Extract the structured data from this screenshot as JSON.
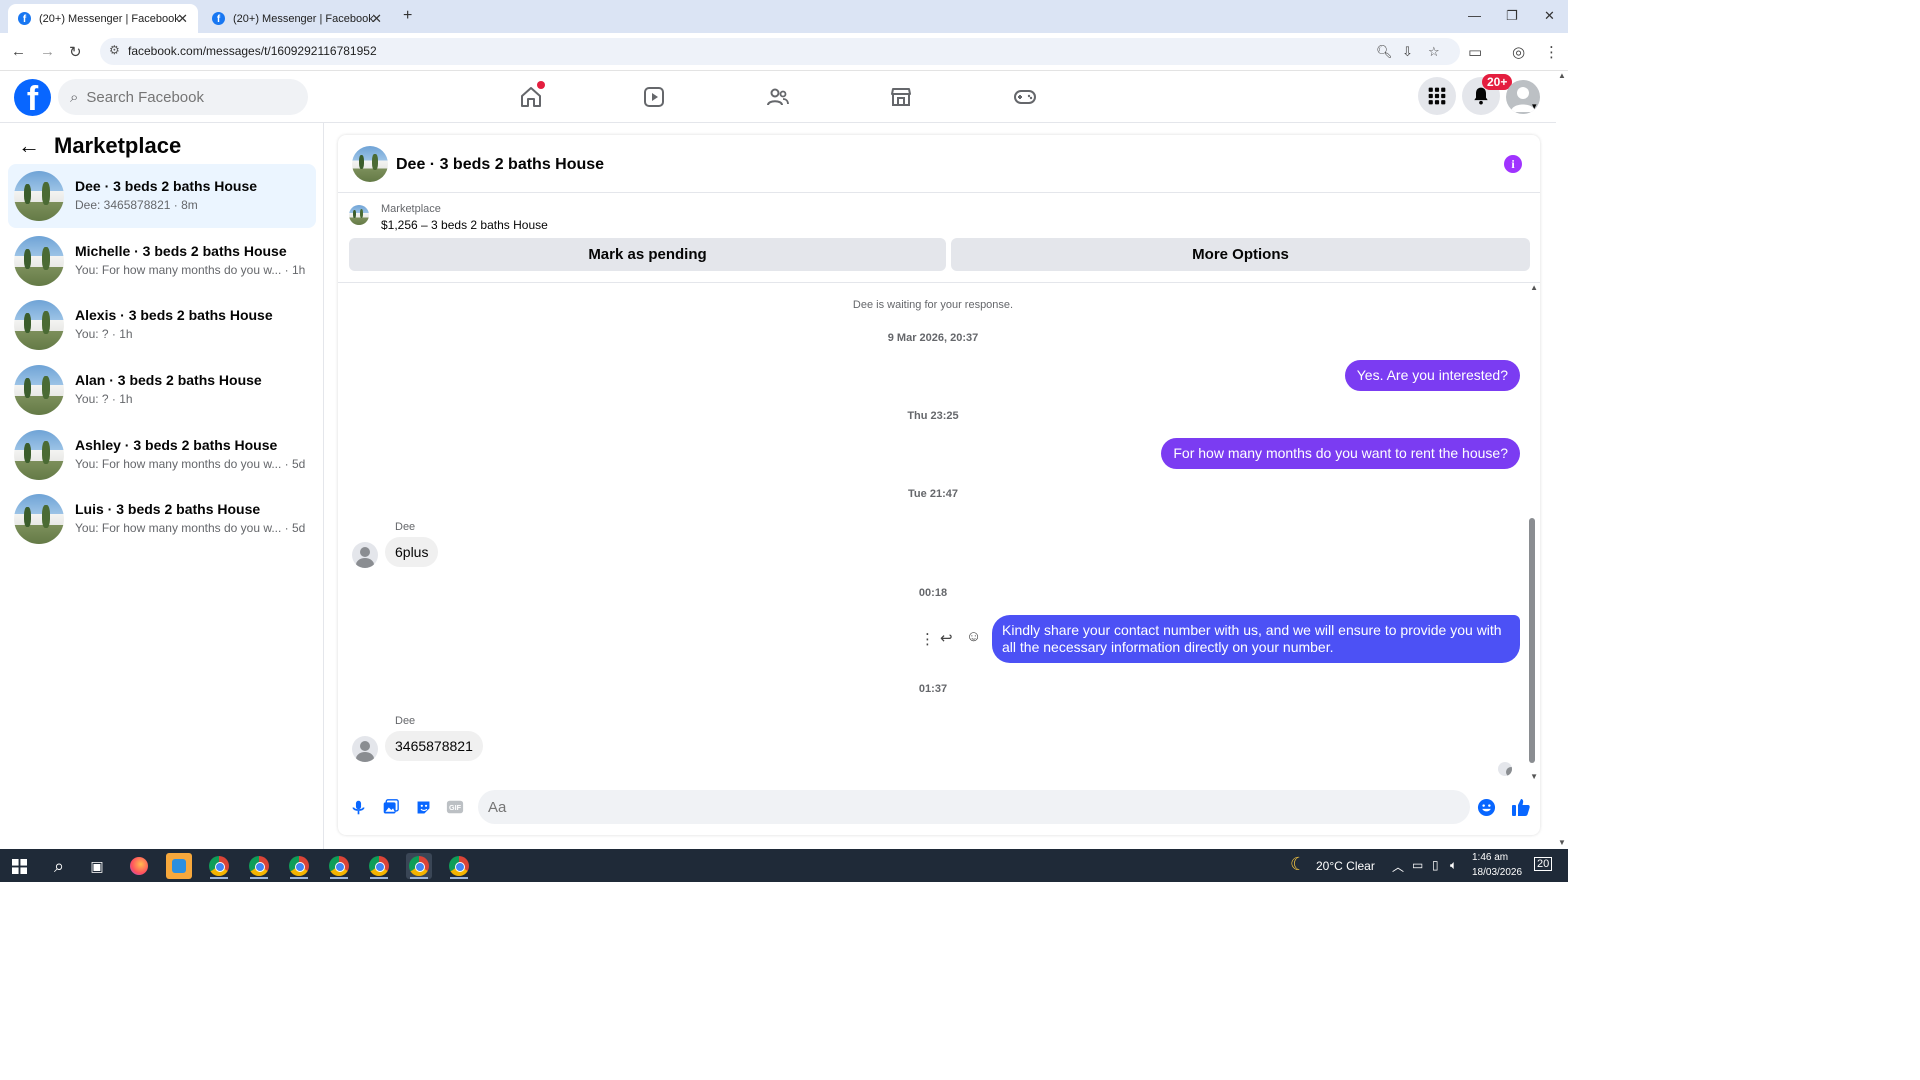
{
  "browser": {
    "tabs": [
      {
        "title": "(20+) Messenger | Facebook"
      },
      {
        "title": "(20+) Messenger | Facebook"
      }
    ],
    "url": "facebook.com/messages/t/1609292116781952"
  },
  "fb_header": {
    "search_placeholder": "Search Facebook",
    "notifications_badge": "20+"
  },
  "sidebar": {
    "title": "Marketplace",
    "conversations": [
      {
        "name": "Dee · 3 beds 2 baths House",
        "preview": "Dee: 3465878821 · 8m"
      },
      {
        "name": "Michelle · 3 beds 2 baths House",
        "preview": "You: For how many months do you w... · 1h"
      },
      {
        "name": "Alexis · 3 beds 2 baths House",
        "preview": "You: ? · 1h"
      },
      {
        "name": "Alan · 3 beds 2 baths House",
        "preview": "You: ? · 1h"
      },
      {
        "name": "Ashley · 3 beds 2 baths House",
        "preview": "You: For how many months do you w... · 5d"
      },
      {
        "name": "Luis · 3 beds 2 baths House",
        "preview": "You: For how many months do you w... · 5d"
      }
    ]
  },
  "chat": {
    "title": "Dee · 3 beds 2 baths House",
    "marketplace_label": "Marketplace",
    "listing": "$1,256 – 3 beds 2 baths House",
    "mark_pending_label": "Mark as pending",
    "more_options_label": "More Options",
    "waiting_note": "Dee is waiting for your response.",
    "messages": [
      {
        "timestamp": "9 Mar 2026, 20:37"
      },
      {
        "text": "Yes. Are you interested?"
      },
      {
        "timestamp": "Thu 23:25"
      },
      {
        "text": "For how many months do you want to rent the house?"
      },
      {
        "timestamp": "Tue 21:47"
      },
      {
        "sender": "Dee",
        "text": "6plus"
      },
      {
        "timestamp": "00:18"
      },
      {
        "text": "Kindly share your contact number with us, and we will ensure to provide you with all the necessary information directly on your number."
      },
      {
        "timestamp": "01:37"
      },
      {
        "sender": "Dee",
        "text": "3465878821"
      }
    ],
    "composer_placeholder": "Aa"
  },
  "taskbar": {
    "weather": "20°C  Clear",
    "time": "1:46 am",
    "date": "18/03/2026",
    "notif_count": "20"
  },
  "colors": {
    "fb_blue": "#0866ff",
    "outgoing_bubble": "#7b3cf2",
    "selected_conv": "#ebf5ff",
    "badge_red": "#e41e3f"
  }
}
